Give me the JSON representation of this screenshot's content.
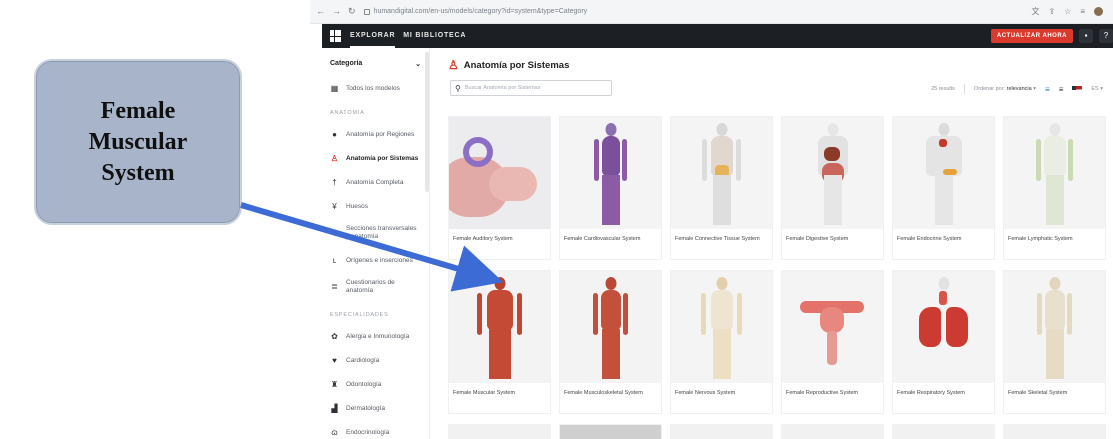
{
  "browser": {
    "url": "humandigital.com/en-us/models/category?id=system&type=Category"
  },
  "topbar": {
    "tabs": [
      {
        "label": "EXPLORAR"
      },
      {
        "label": "MI BIBLIOTECA"
      }
    ],
    "cta_label": "ACTUALIZAR AHORA"
  },
  "sidebar": {
    "category_label": "Categoría",
    "all_models": "Todos los modelos",
    "section_anatomy": "ANATOMÍA",
    "items": [
      {
        "label": "Anatomía por Regiones",
        "icon": "torso-icon"
      },
      {
        "label": "Anatomía por Sistemas",
        "icon": "systems-icon"
      },
      {
        "label": "Anatomía Completa",
        "icon": "figure-icon"
      },
      {
        "label": "Huesos",
        "icon": "bone-icon"
      },
      {
        "label": "Secciones transversales y anatomía",
        "icon": "section-icon"
      },
      {
        "label": "Orígenes e inserciones",
        "icon": "leg-icon"
      },
      {
        "label": "Cuestionarios de anatomía",
        "icon": "quiz-icon"
      }
    ],
    "section_specialties": "ESPECIALIDADES",
    "specialties": [
      {
        "label": "Alergia e Inmunología",
        "icon": "allergy-icon"
      },
      {
        "label": "Cardiología",
        "icon": "heart-icon"
      },
      {
        "label": "Odontología",
        "icon": "tooth-icon"
      },
      {
        "label": "Dermatología",
        "icon": "skin-icon"
      },
      {
        "label": "Endocrinología",
        "icon": "thyroid-icon"
      }
    ]
  },
  "main": {
    "title": "Anatomía por Sistemas",
    "search_placeholder": "Buscar Anatomía por Sistemas",
    "result_count": "25 results",
    "sort_label": "Ordenar por:",
    "sort_value": "relevancia",
    "lang": "ES",
    "cards": [
      {
        "caption": "Female Auditory System"
      },
      {
        "caption": "Female Cardiovascular System"
      },
      {
        "caption": "Female Connective Tissue System"
      },
      {
        "caption": "Female Digestive System"
      },
      {
        "caption": "Female Endocrine System"
      },
      {
        "caption": "Female Lymphatic System"
      },
      {
        "caption": "Female Muscular System"
      },
      {
        "caption": "Female Musculoskeletal System"
      },
      {
        "caption": "Female Nervous System"
      },
      {
        "caption": "Female Reproductive System"
      },
      {
        "caption": "Female Respiratory System"
      },
      {
        "caption": "Female Skeletal System"
      }
    ]
  },
  "callout": {
    "text": "Female\nMuscular\nSystem"
  },
  "colors": {
    "accent": "#d93a2b",
    "topbar": "#1c1f24",
    "callout": "#a7b4c9",
    "arrow": "#3d6bd6"
  }
}
